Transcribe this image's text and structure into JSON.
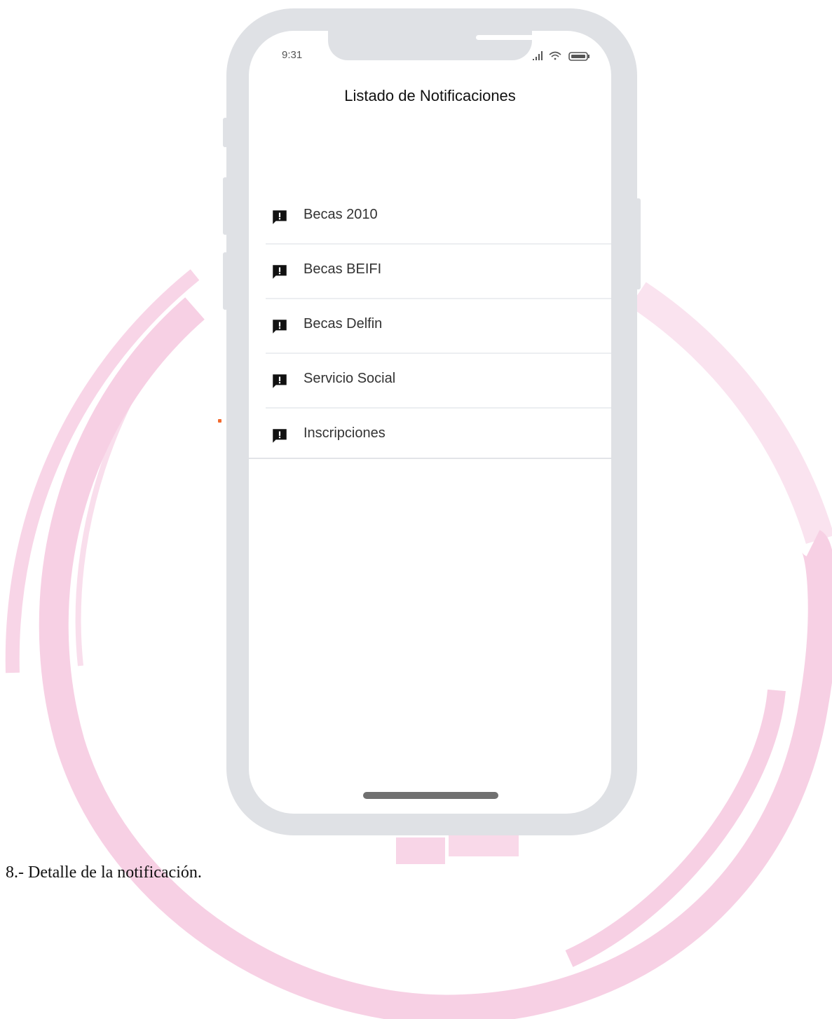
{
  "status_bar": {
    "time": "9:31"
  },
  "screen": {
    "title": "Listado de Notificaciones"
  },
  "notifications": [
    {
      "label": "Becas 2010",
      "icon": "feedback-icon"
    },
    {
      "label": "Becas BEIFI",
      "icon": "feedback-icon"
    },
    {
      "label": "Becas Delfin",
      "icon": "feedback-icon"
    },
    {
      "label": "Servicio Social",
      "icon": "feedback-icon"
    },
    {
      "label": "Inscripciones",
      "icon": "feedback-icon"
    }
  ],
  "caption": "8.- Detalle de la notificación.",
  "colors": {
    "watermark": "#f7cde3",
    "phone_frame": "#dfe1e5",
    "accent_dot": "#f26a2e"
  }
}
